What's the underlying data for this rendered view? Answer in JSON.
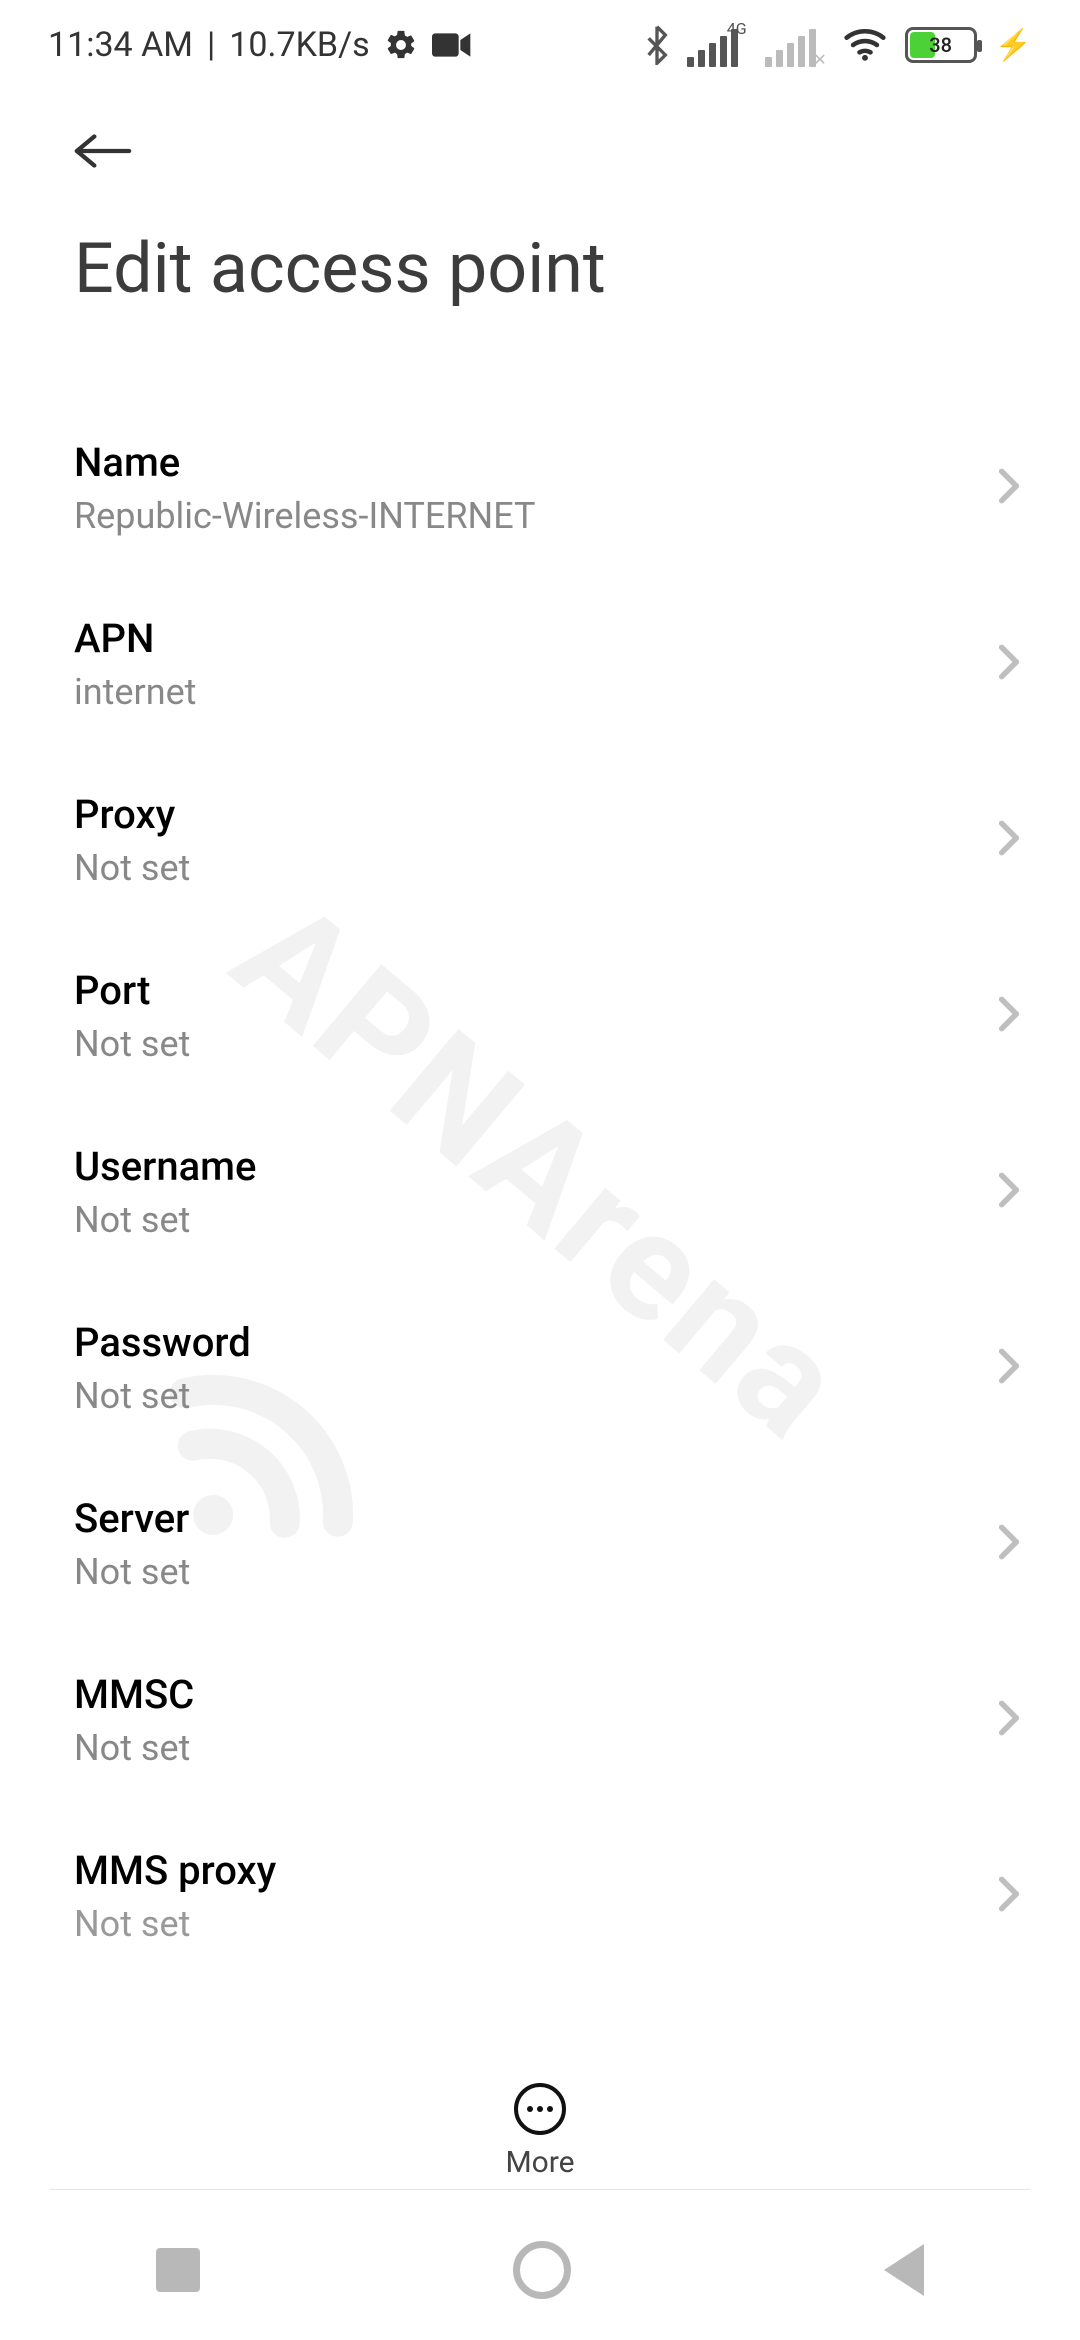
{
  "status": {
    "time": "11:34 AM",
    "sep": "|",
    "speed": "10.7KB/s",
    "sig1_label": "4G",
    "battery_pct": "38"
  },
  "header": {
    "title": "Edit access point"
  },
  "rows": [
    {
      "title": "Name",
      "value": "Republic-Wireless-INTERNET"
    },
    {
      "title": "APN",
      "value": "internet"
    },
    {
      "title": "Proxy",
      "value": "Not set"
    },
    {
      "title": "Port",
      "value": "Not set"
    },
    {
      "title": "Username",
      "value": "Not set"
    },
    {
      "title": "Password",
      "value": "Not set"
    },
    {
      "title": "Server",
      "value": "Not set"
    },
    {
      "title": "MMSC",
      "value": "Not set"
    },
    {
      "title": "MMS proxy",
      "value": "Not set"
    }
  ],
  "bottom": {
    "more_label": "More"
  },
  "watermark": "APNArena"
}
